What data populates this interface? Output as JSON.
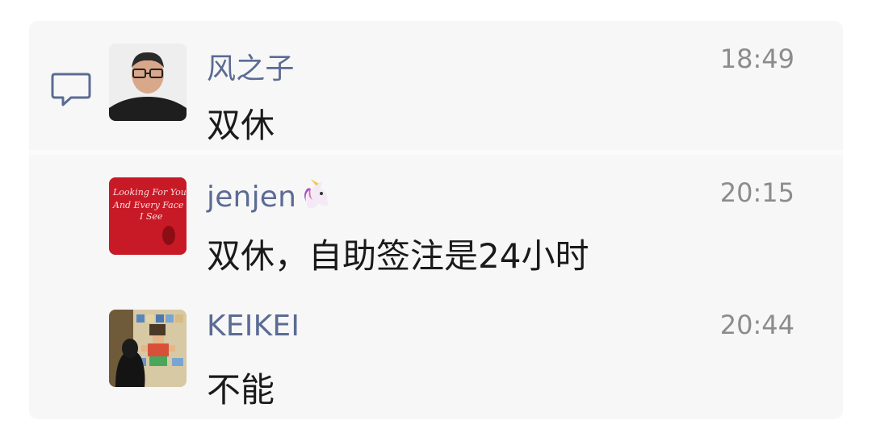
{
  "comments": [
    {
      "name": "风之子",
      "time": "18:49",
      "text": "双休",
      "avatar": "avatar-man-glasses"
    },
    {
      "name": "jenjen",
      "name_emoji": "unicorn",
      "time": "20:15",
      "text": "双休，自助签注是24小时",
      "avatar": "avatar-red-neon",
      "avatar_text": "Looking For You And Every Face I See"
    },
    {
      "name": "KEIKEI",
      "time": "20:44",
      "text": "不能",
      "avatar": "avatar-mosaic-wall"
    }
  ],
  "colors": {
    "name": "#5b6b93",
    "time": "#8c8c8c",
    "text": "#1a1a1a",
    "panel": "#f7f7f7"
  },
  "icons": {
    "section": "comment-bubble-icon"
  }
}
